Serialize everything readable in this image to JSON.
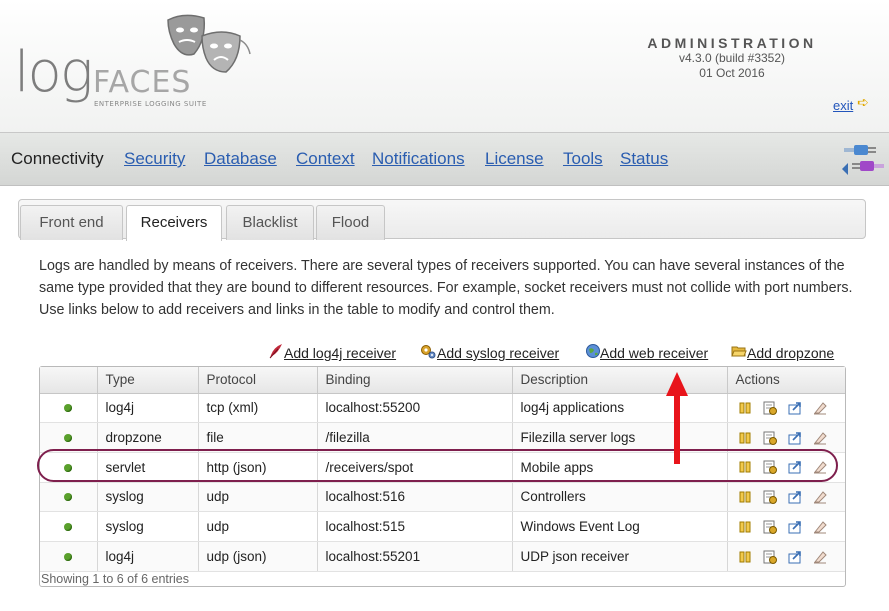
{
  "brand": {
    "logo_log": "log",
    "logo_faces": "FACES",
    "tagline": "ENTERPRISE LOGGING SUITE",
    "logo_icon": "theatre-masks-icon"
  },
  "admin": {
    "title": "ADMINISTRATION",
    "version": "v4.3.0 (build #3352)",
    "date": "01 Oct 2016",
    "exit_label": "exit",
    "exit_icon": "arrow-right-icon"
  },
  "nav": {
    "current": "Connectivity",
    "links": [
      "Security",
      "Database",
      "Context",
      "Notifications",
      "License",
      "Tools",
      "Status"
    ],
    "plug_icon": "plug-icon"
  },
  "tabs": [
    {
      "label": "Front end",
      "active": false
    },
    {
      "label": "Receivers",
      "active": true
    },
    {
      "label": "Blacklist",
      "active": false
    },
    {
      "label": "Flood",
      "active": false
    }
  ],
  "description": "Logs are handled by means of receivers. There are several types of receivers supported. You can have several instances of the same type provided that they are bound to different resources. For example, socket receivers must not collide with port numbers. Use links below to add receivers and links in the table to modify and control them.",
  "add_links": {
    "log4j": "Add log4j receiver",
    "syslog": "Add syslog receiver",
    "web": "Add web receiver",
    "dropzone": "Add dropzone"
  },
  "table": {
    "columns": [
      "",
      "Type",
      "Protocol",
      "Binding",
      "Description",
      "Actions"
    ],
    "rows": [
      {
        "status": "running",
        "type": "log4j",
        "protocol": "tcp (xml)",
        "binding": "localhost:55200",
        "description": "log4j applications"
      },
      {
        "status": "running",
        "type": "dropzone",
        "protocol": "file",
        "binding": "/filezilla",
        "description": "Filezilla server logs"
      },
      {
        "status": "running",
        "type": "servlet",
        "protocol": "http (json)",
        "binding": "/receivers/spot",
        "description": "Mobile apps"
      },
      {
        "status": "running",
        "type": "syslog",
        "protocol": "udp",
        "binding": "localhost:516",
        "description": "Controllers"
      },
      {
        "status": "running",
        "type": "syslog",
        "protocol": "udp",
        "binding": "localhost:515",
        "description": "Windows Event Log"
      },
      {
        "status": "running",
        "type": "log4j",
        "protocol": "udp (json)",
        "binding": "localhost:55201",
        "description": "UDP json receiver"
      }
    ],
    "action_icons": [
      "pause-icon",
      "edit-icon",
      "export-icon",
      "delete-icon"
    ],
    "footer": "Showing 1 to 6 of 6 entries"
  },
  "colors": {
    "link": "#2a5db0",
    "status_running": "#5aa02c",
    "highlight": "#7e1f4d",
    "annotation_arrow": "#e8141b"
  }
}
